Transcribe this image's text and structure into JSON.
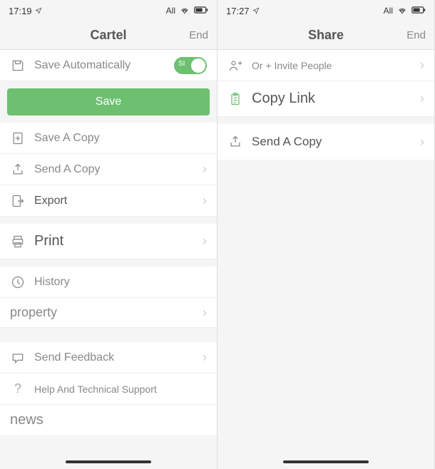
{
  "left": {
    "status": {
      "time": "17:19",
      "carrier": "All"
    },
    "header": {
      "title": "Cartel",
      "right": "End"
    },
    "saveAuto": {
      "label": "Save Automatically",
      "toggleText": "SI"
    },
    "saveBtn": "Save",
    "saveCopy": "Save A Copy",
    "sendCopy": "Send A Copy",
    "export": "Export",
    "print": "Print",
    "history": "History",
    "property": "property",
    "feedback": "Send Feedback",
    "help": "Help And Technical Support",
    "news": "news"
  },
  "right": {
    "status": {
      "time": "17:27",
      "carrier": "All"
    },
    "header": {
      "title": "Share",
      "right": "End"
    },
    "invite": "Or + Invite People",
    "copyLink": "Copy Link",
    "sendCopy": "Send A Copy"
  }
}
